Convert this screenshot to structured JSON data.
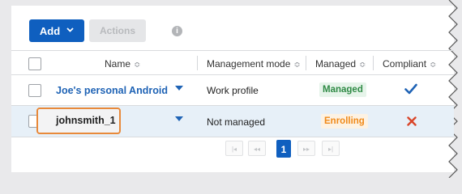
{
  "toolbar": {
    "add_label": "Add",
    "actions_label": "Actions",
    "info_glyph": "i"
  },
  "table": {
    "columns": [
      {
        "label": "Name"
      },
      {
        "label": "Management mode"
      },
      {
        "label": "Managed"
      },
      {
        "label": "Compliant"
      }
    ],
    "sort_glyph": "≎",
    "rows": [
      {
        "name": "Joe's personal Android",
        "management_mode": "Work profile",
        "managed_status": "Managed",
        "compliant_glyph": "✔",
        "compliant_icon": "checkmark-icon",
        "compliant_color": "#1f63b5"
      },
      {
        "name": "johnsmith_1",
        "management_mode": "Not managed",
        "managed_status": "Enrolling",
        "compliant_glyph": "✕",
        "compliant_icon": "cross-icon",
        "compliant_color": "#d9462a",
        "selected": true
      }
    ]
  },
  "pagination": {
    "first_glyph": "|◂",
    "prev_glyph": "◂◂",
    "current_page": "1",
    "next_glyph": "▸▸",
    "last_glyph": "▸|"
  },
  "colors": {
    "accent": "#0f5fbf",
    "managed": "#2f8a45",
    "enrolling": "#f08a1a",
    "highlight": "#e8893a"
  }
}
